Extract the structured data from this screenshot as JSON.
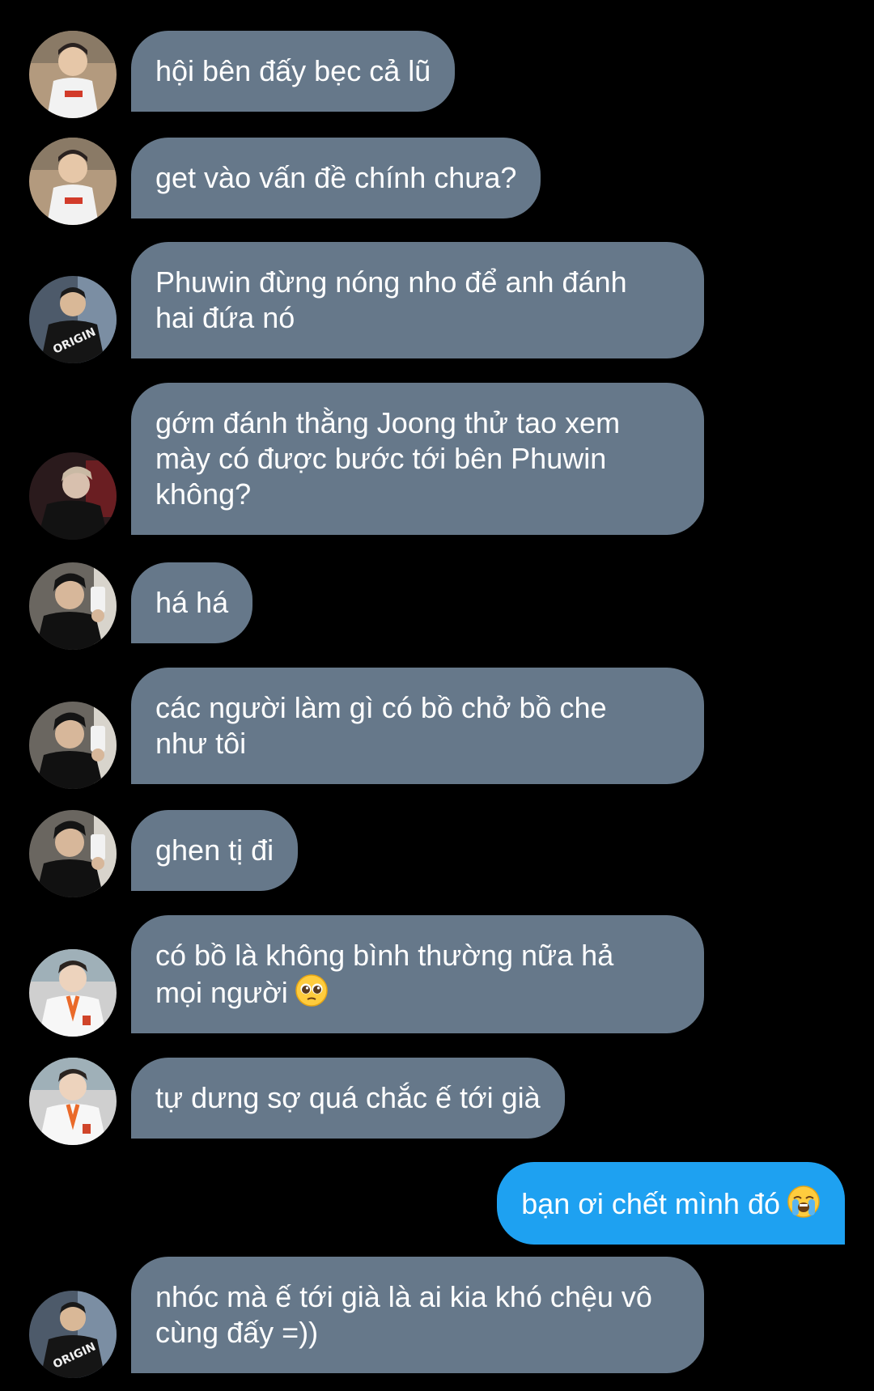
{
  "messages": [
    {
      "sender": "in",
      "avatar": "avatar-jersey",
      "text": "hội bên đấy bẹc cả lũ"
    },
    {
      "sender": "in",
      "avatar": "avatar-jersey",
      "text": "get vào vấn đề chính chưa?"
    },
    {
      "sender": "in",
      "avatar": "avatar-original-tee",
      "text": "Phuwin đừng nóng nho để anh đánh\nhai đứa nó"
    },
    {
      "sender": "in",
      "avatar": "avatar-dark-red",
      "text": "gớm đánh thằng Joong thử tao xem\nmày có được bước tới bên Phuwin\nkhông?"
    },
    {
      "sender": "in",
      "avatar": "avatar-mirror-selfie",
      "text": "há há"
    },
    {
      "sender": "in",
      "avatar": "avatar-mirror-selfie",
      "text": "các người làm gì có bồ chở bồ che\nnhư tôi"
    },
    {
      "sender": "in",
      "avatar": "avatar-mirror-selfie",
      "text": "ghen tị đi"
    },
    {
      "sender": "in",
      "avatar": "avatar-school-uniform",
      "text": "có bồ là không bình thường nữa hả\nmọi người",
      "emoji": "pleading-face-emoji"
    },
    {
      "sender": "in",
      "avatar": "avatar-school-uniform",
      "text": "tự dưng sợ quá chắc ế tới già"
    },
    {
      "sender": "out",
      "text": "bạn ơi chết mình đó",
      "emoji": "loudly-crying-face-emoji"
    },
    {
      "sender": "in",
      "avatar": "avatar-original-tee",
      "text": "nhóc mà ế tới già là ai kia khó chệu vô\ncùng đấy =))"
    }
  ],
  "colors": {
    "background": "#000000",
    "incoming_bubble": "#66788a",
    "outgoing_bubble": "#1ea1f1",
    "text": "#ffffff"
  }
}
